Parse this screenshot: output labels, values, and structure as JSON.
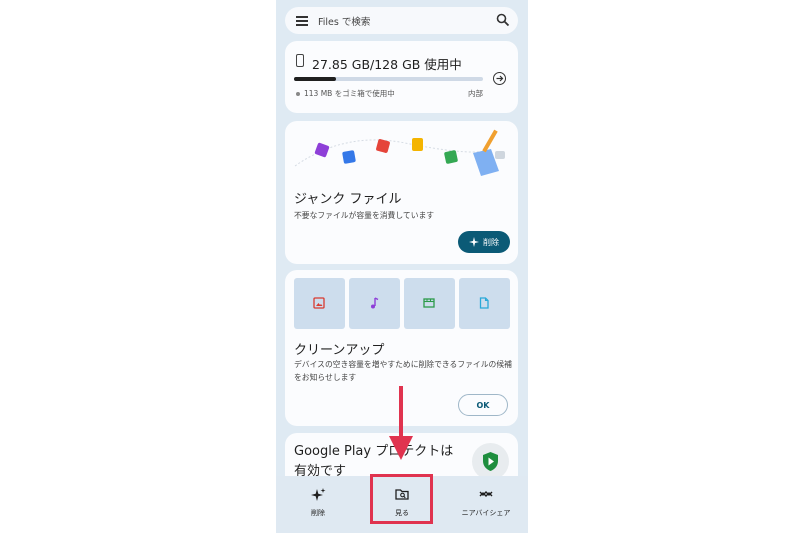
{
  "search": {
    "placeholder": "Files で検索"
  },
  "storage": {
    "title": "27.85 GB/128 GB 使用中",
    "used_fraction": 0.22,
    "trash_note": "113 MB をゴミ箱で使用中",
    "location": "内部"
  },
  "junk": {
    "title": "ジャンク ファイル",
    "description": "不要なファイルが容量を消費しています",
    "button": "削除"
  },
  "cleanup": {
    "title": "クリーンアップ",
    "description": "デバイスの空き容量を増やすために削除できるファイルの候補をお知らせします",
    "button": "OK",
    "tiles": [
      "image-icon",
      "music-icon",
      "video-icon",
      "document-icon"
    ]
  },
  "google_play": {
    "title": "Google Play プロテクトは有効です"
  },
  "bottom_nav": {
    "items": [
      {
        "label": "削除",
        "icon": "sparkle-icon"
      },
      {
        "label": "見る",
        "icon": "browse-folder-icon"
      },
      {
        "label": "ニアバイシェア",
        "icon": "nearby-share-icon"
      }
    ]
  },
  "colors": {
    "accent": "#0b5a76",
    "background": "#dfeaf3",
    "annotation_red": "#e0334f"
  }
}
